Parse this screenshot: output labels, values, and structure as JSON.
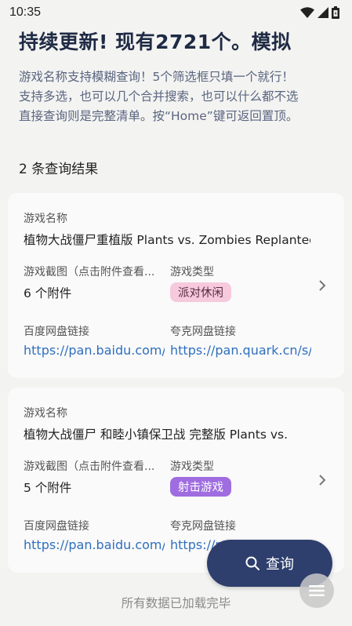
{
  "status_bar": {
    "time": "10:35",
    "icons": [
      "wifi-icon",
      "cellular-signal-icon",
      "battery-icon"
    ]
  },
  "header": {
    "title": "持续更新! 现有2721个。模拟",
    "description_lines": [
      "游戏名称支持模糊查询！5个筛选框只填一个就行！",
      "支持多选，也可以几个合并搜索，也可以什么都不选",
      "直接查询则是完整清单。按“Home”键可返回置顶。"
    ]
  },
  "results": {
    "count_label": "2 条查询结果",
    "field_labels": {
      "name": "游戏名称",
      "screenshots": "游戏截图（点击附件查看...",
      "type": "游戏类型",
      "baidu": "百度网盘链接",
      "quark": "夸克网盘链接"
    },
    "items": [
      {
        "name": "植物大战僵尸重植版 Plants vs. Zombies Replanted",
        "attachments": "6 个附件",
        "type": "派对休闲",
        "type_color": "#f6c9dd",
        "baidu_link": "https://pan.baidu.com/",
        "quark_link": "https://pan.quark.cn/s/"
      },
      {
        "name": "植物大战僵尸 和睦小镇保卫战 完整版 Plants vs.",
        "attachments": "5 个附件",
        "type": "射击游戏",
        "type_color": "#a06de0",
        "baidu_link": "https://pan.baidu.com/",
        "quark_link": "https://pan.quark.cn/s/"
      }
    ]
  },
  "footer": {
    "text": "所有数据已加载完毕"
  },
  "search_button": {
    "label": "查询"
  },
  "colors": {
    "accent": "#2e3f6e",
    "link": "#2f6fbe",
    "title": "#1f2a44"
  }
}
